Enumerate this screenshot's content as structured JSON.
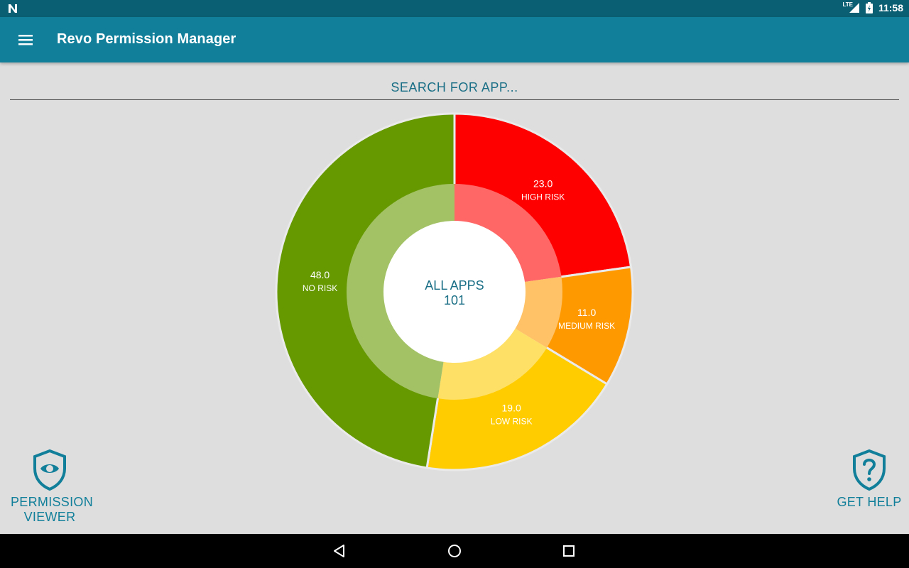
{
  "status_bar": {
    "time": "11:58",
    "network": "LTE"
  },
  "app_bar": {
    "title": "Revo Permission Manager"
  },
  "search": {
    "placeholder": "SEARCH FOR APP..."
  },
  "chart_data": {
    "type": "pie",
    "center_label": "ALL APPS",
    "center_value": "101",
    "slices": [
      {
        "label": "HIGH RISK",
        "value": "23.0",
        "amount": 23,
        "color": "#ff0000",
        "inner_color": "#ff6666"
      },
      {
        "label": "MEDIUM RISK",
        "value": "11.0",
        "amount": 11,
        "color": "#ff9900",
        "inner_color": "#ffc266"
      },
      {
        "label": "LOW RISK",
        "value": "19.0",
        "amount": 19,
        "color": "#ffcc00",
        "inner_color": "#ffe066"
      },
      {
        "label": "NO RISK",
        "value": "48.0",
        "amount": 48,
        "color": "#669900",
        "inner_color": "#a3c266"
      }
    ]
  },
  "buttons": {
    "permission_viewer": "PERMISSION VIEWER",
    "get_help": "GET HELP"
  },
  "colors": {
    "accent": "#117f9a",
    "status_bar": "#0b5f73",
    "background": "#dedede"
  }
}
